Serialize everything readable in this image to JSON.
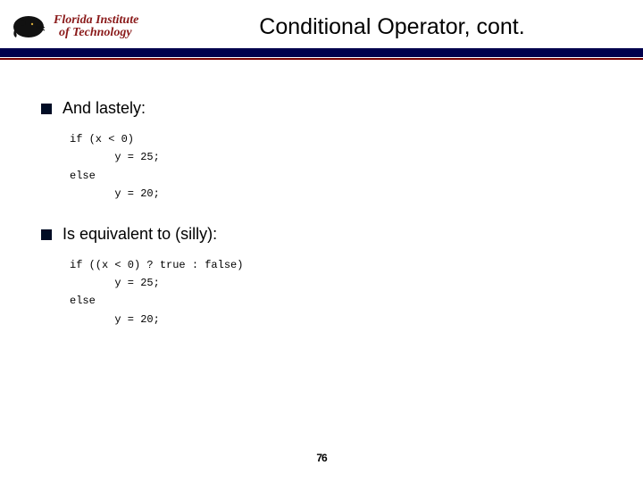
{
  "logo": {
    "line1": "Florida Institute",
    "line2": "of Technology"
  },
  "title": "Conditional Operator, cont.",
  "bullets": [
    {
      "text": "And lastely:"
    },
    {
      "text": "Is equivalent to (silly):"
    }
  ],
  "code_blocks": [
    "if (x < 0)\n       y = 25;\nelse\n       y = 20;",
    "if ((x < 0) ? true : false)\n       y = 25;\nelse\n       y = 20;"
  ],
  "page_number": "76"
}
